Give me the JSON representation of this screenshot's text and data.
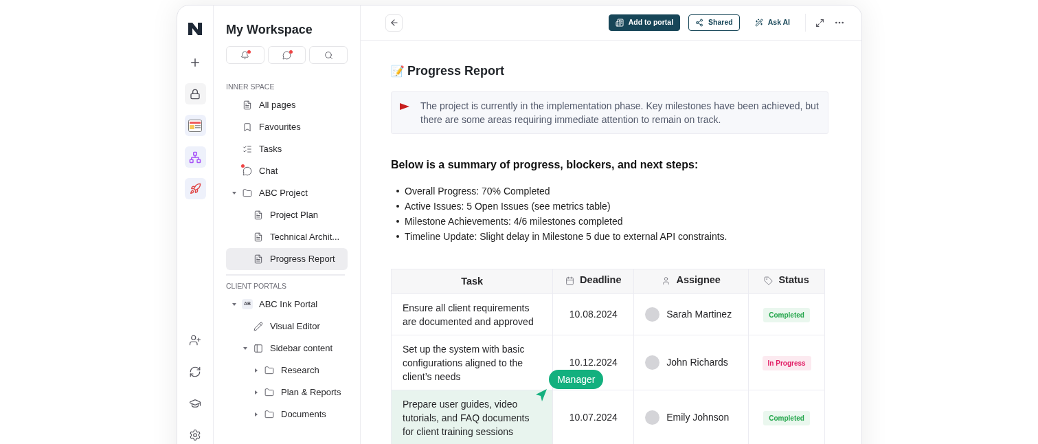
{
  "sidebar": {
    "title": "My Workspace",
    "header_buttons": [
      {
        "kind": "bell",
        "unread": true
      },
      {
        "kind": "chat",
        "unread": true
      },
      {
        "kind": "search"
      }
    ],
    "sections": [
      {
        "label": "INNER SPACE",
        "items": [
          {
            "label": "All pages",
            "kind": "page",
            "selected": false
          },
          {
            "label": "Favourites",
            "kind": "bookmark",
            "selected": false
          },
          {
            "label": "Tasks",
            "kind": "tasks",
            "selected": false
          },
          {
            "label": "Chat",
            "kind": "chat",
            "unread": true,
            "selected": false
          },
          {
            "label": "ABC Project",
            "kind": "folder",
            "expanded": true,
            "selected": false,
            "children": [
              {
                "label": "Project Plan",
                "kind": "page",
                "selected": false
              },
              {
                "label": "Technical Archit...",
                "kind": "page",
                "selected": false
              },
              {
                "label": "Progress Report",
                "kind": "page",
                "selected": true
              }
            ]
          }
        ]
      },
      {
        "label": "CLIENT PORTALS",
        "items": [
          {
            "label": "ABC Ink Portal",
            "kind": "portal",
            "badge": "AB",
            "expanded": true,
            "selected": false,
            "children": [
              {
                "label": "Visual Editor",
                "kind": "edit",
                "selected": false
              },
              {
                "label": "Sidebar content",
                "kind": "sidebar",
                "expanded": true,
                "selected": false,
                "children": [
                  {
                    "label": "Research",
                    "kind": "folder",
                    "expanded": false,
                    "selected": false
                  },
                  {
                    "label": "Plan & Reports",
                    "kind": "folder",
                    "expanded": false,
                    "selected": false
                  },
                  {
                    "label": "Documents",
                    "kind": "folder",
                    "expanded": false,
                    "selected": false
                  }
                ]
              }
            ]
          }
        ]
      }
    ]
  },
  "toolbar": {
    "buttons": [
      {
        "label": "Add to portal",
        "kind": "primary"
      },
      {
        "label": "Shared",
        "kind": "outline"
      },
      {
        "label": "Ask AI",
        "kind": "ghost"
      }
    ]
  },
  "document": {
    "title_emoji": "📝",
    "title": "Progress Report",
    "callout": "The project is currently in the implementation phase. Key milestones have been achieved, but there are some areas requiring immediate attention to remain on track.",
    "heading": "Below is a summary of progress, blockers, and next steps:",
    "bullets": [
      "Overall Progress: 70% Completed",
      "Active Issues: 5 Open Issues (see metrics table)",
      "Milestone Achievements: 4/6 milestones completed",
      "Timeline Update: Slight delay in Milestone 5 due to external API constraints."
    ],
    "table": {
      "columns": [
        {
          "label": "Task",
          "kind": "text"
        },
        {
          "label": "Deadline",
          "kind": "date"
        },
        {
          "label": "Assignee",
          "kind": "person"
        },
        {
          "label": "Status",
          "kind": "tag"
        }
      ],
      "rows": [
        {
          "task": "Ensure all client requirements are documented and approved",
          "deadline": "10.08.2024",
          "assignee": "Sarah Martinez",
          "status": "Completed",
          "color": "#22a54a"
        },
        {
          "task": "Set up the system with basic configurations aligned to the client’s needs",
          "deadline": "10.12.2024",
          "assignee": "John Richards",
          "status": "In Progress",
          "color": "#e11d64"
        },
        {
          "task": "Prepare user guides, video tutorials, and FAQ documents for client training sessions",
          "deadline": "10.07.2024",
          "assignee": "Emily Johnson",
          "status": "Completed",
          "color": "#22a54a",
          "cursor": "Manager"
        }
      ]
    }
  }
}
